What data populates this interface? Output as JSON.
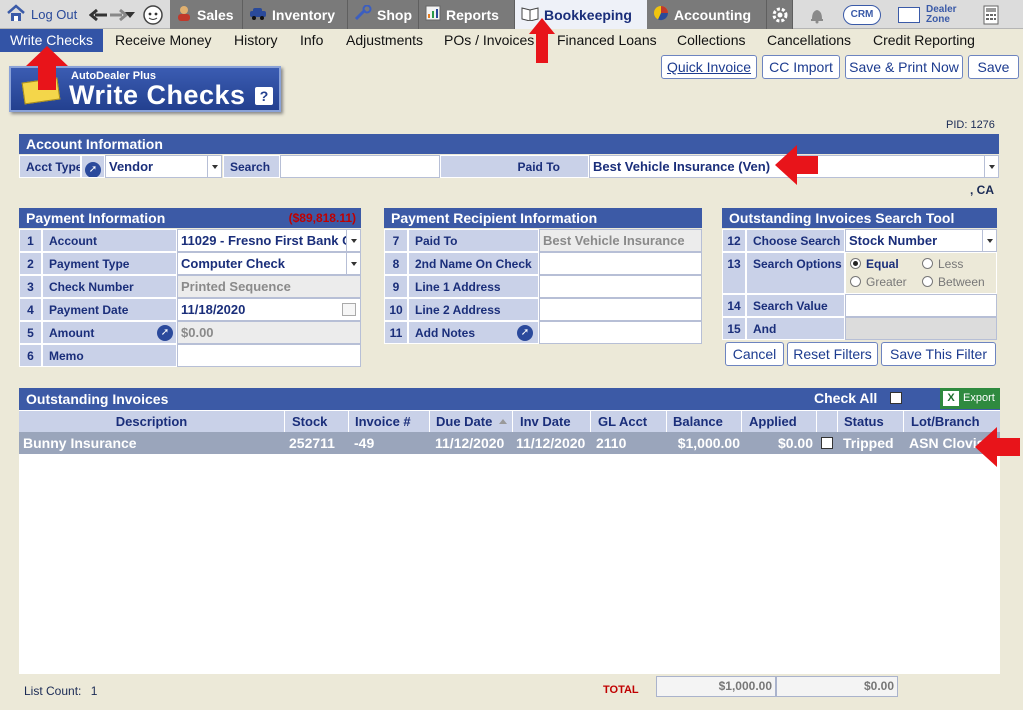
{
  "top_nav": {
    "logout": "Log Out",
    "tabs": [
      {
        "label": "Sales",
        "icon": "person-icon"
      },
      {
        "label": "Inventory",
        "icon": "car-icon"
      },
      {
        "label": "Shop",
        "icon": "wrench-icon"
      },
      {
        "label": "Reports",
        "icon": "report-icon"
      },
      {
        "label": "Bookkeeping",
        "icon": "book-icon",
        "active": true
      },
      {
        "label": "Accounting",
        "icon": "pie-chart-icon"
      }
    ],
    "crm": "CRM",
    "dealer_zone": "Dealer\nZone"
  },
  "sub_nav": [
    "Write Checks",
    "Receive Money",
    "History",
    "Info",
    "Adjustments",
    "POs / Invoices",
    "Financed Loans",
    "Collections",
    "Cancellations",
    "Credit Reporting"
  ],
  "logo": {
    "small": "AutoDealer Plus",
    "big": "Write Checks",
    "help": "?"
  },
  "actions": {
    "quick_invoice": "Quick Invoice",
    "cc_import": "CC Import",
    "save_print": "Save & Print Now",
    "save": "Save"
  },
  "pid": "PID: 1276",
  "account": {
    "title": "Account Information",
    "acct_type_label": "Acct Type",
    "acct_type_value": "Vendor",
    "search_label": "Search",
    "search_value": "",
    "paid_to_label": "Paid To",
    "paid_to_value": "Best Vehicle Insurance (Ven)",
    "location": ", CA"
  },
  "payment": {
    "title": "Payment Information",
    "balance": "($89,818.11)",
    "rows": [
      {
        "n": "1",
        "label": "Account",
        "value": "11029 - Fresno First Bank C"
      },
      {
        "n": "2",
        "label": "Payment Type",
        "value": "Computer Check"
      },
      {
        "n": "3",
        "label": "Check Number",
        "value": "Printed Sequence"
      },
      {
        "n": "4",
        "label": "Payment Date",
        "value": "11/18/2020"
      },
      {
        "n": "5",
        "label": "Amount",
        "value": "$0.00"
      },
      {
        "n": "6",
        "label": "Memo",
        "value": ""
      }
    ]
  },
  "recipient": {
    "title": "Payment Recipient Information",
    "rows": [
      {
        "n": "7",
        "label": "Paid To",
        "value": "Best Vehicle Insurance"
      },
      {
        "n": "8",
        "label": "2nd Name On Check",
        "value": ""
      },
      {
        "n": "9",
        "label": "Line 1 Address",
        "value": ""
      },
      {
        "n": "10",
        "label": "Line 2 Address",
        "value": ""
      },
      {
        "n": "11",
        "label": "Add Notes",
        "value": ""
      }
    ]
  },
  "search_tool": {
    "title": "Outstanding Invoices Search Tool",
    "rows": [
      {
        "n": "12",
        "label": "Choose Search",
        "value": "Stock Number"
      },
      {
        "n": "13",
        "label": "Search Options"
      },
      {
        "n": "14",
        "label": "Search Value",
        "value": ""
      },
      {
        "n": "15",
        "label": "And",
        "value": ""
      }
    ],
    "options": {
      "equal": "Equal",
      "less": "Less",
      "greater": "Greater",
      "between": "Between"
    },
    "buttons": {
      "cancel": "Cancel",
      "reset": "Reset Filters",
      "save": "Save This Filter"
    }
  },
  "invoices": {
    "title": "Outstanding Invoices",
    "check_all": "Check All",
    "export": "Export",
    "columns": [
      "Description",
      "Stock",
      "Invoice #",
      "Due Date",
      "Inv Date",
      "GL Acct",
      "Balance",
      "Applied",
      "Status",
      "Lot/Branch"
    ],
    "rows": [
      {
        "description": "Bunny Insurance",
        "stock": "252711",
        "invoice": "-49",
        "due": "11/12/2020",
        "inv": "11/12/2020",
        "gl": "2110",
        "balance": "$1,000.00",
        "applied": "$0.00",
        "status": "Tripped",
        "lot": "ASN Clovis"
      }
    ]
  },
  "footer": {
    "list_count_label": "List Count:",
    "list_count": "1",
    "total_label": "TOTAL",
    "total_balance": "$1,000.00",
    "total_applied": "$0.00"
  }
}
